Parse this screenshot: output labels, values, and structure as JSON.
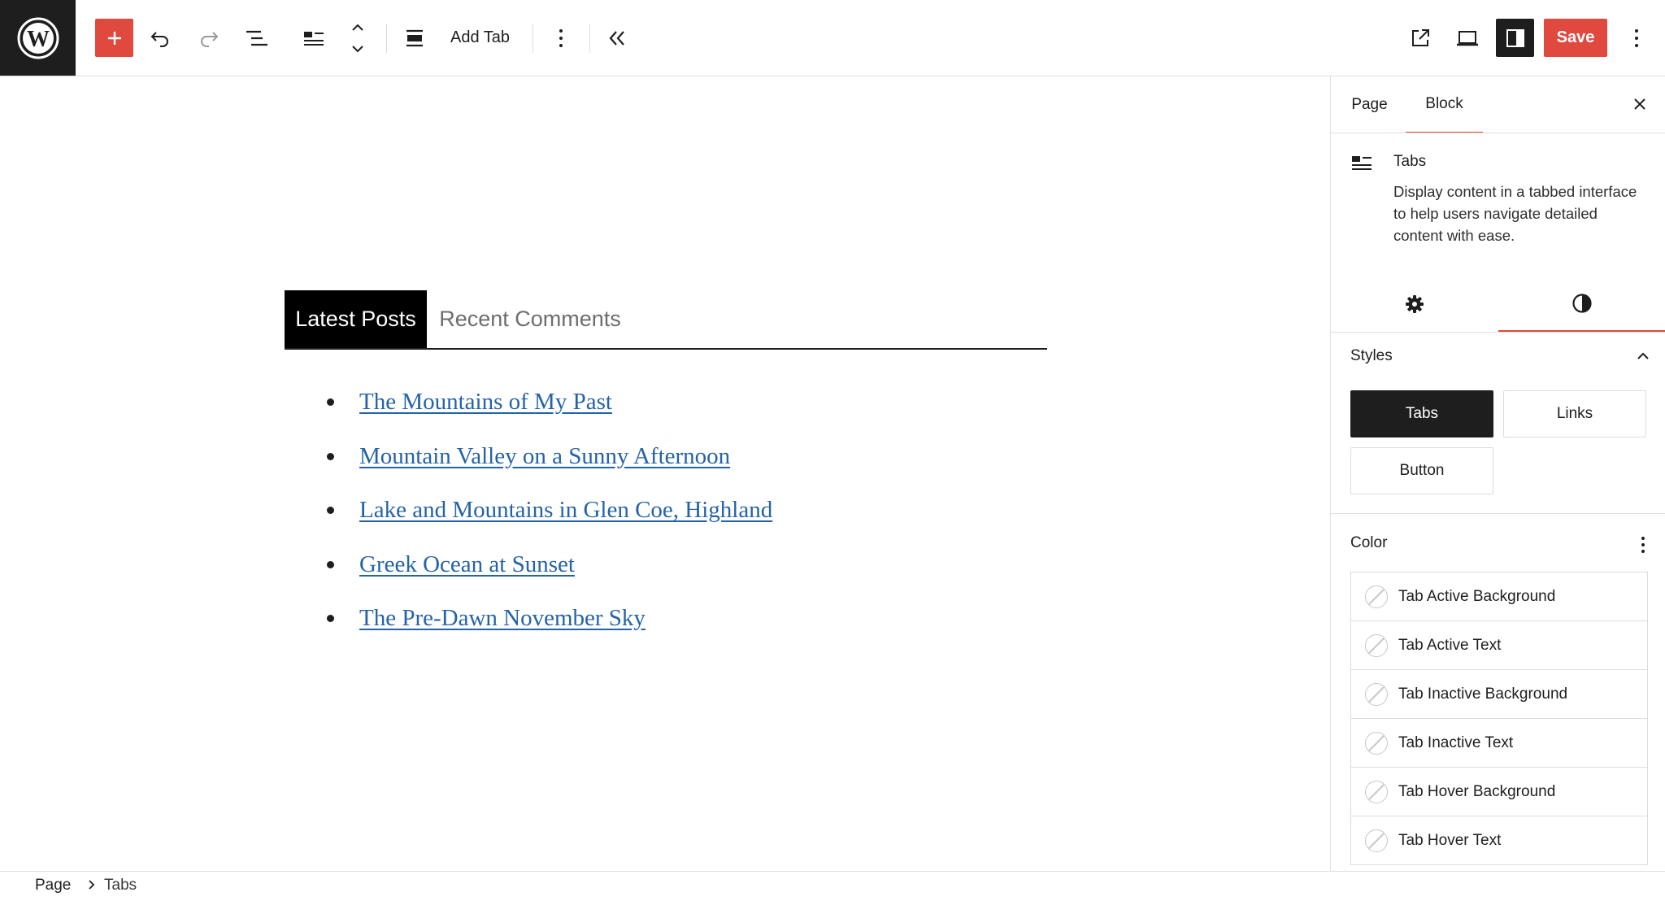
{
  "toolbar": {
    "add_tab_label": "Add Tab",
    "save_label": "Save",
    "accent_color": "#e0493d",
    "icons": [
      "wordpress-logo",
      "plus",
      "undo",
      "redo",
      "document-overview",
      "tabs-block",
      "move-up-down",
      "align",
      "more-vertical",
      "collapse",
      "external-preview",
      "device-preview",
      "sidebar-settings",
      "more-vertical"
    ]
  },
  "canvas": {
    "tabs": [
      {
        "label": "Latest Posts",
        "active": true
      },
      {
        "label": "Recent Comments",
        "active": false
      }
    ],
    "posts": [
      "The Mountains of My Past",
      "Mountain Valley on a Sunny Afternoon",
      "Lake and Mountains in Glen Coe, Highland",
      "Greek Ocean at Sunset",
      "The Pre-Dawn November Sky"
    ],
    "link_color": "#2563a8"
  },
  "sidebar": {
    "tabs": {
      "page": "Page",
      "block": "Block"
    },
    "block_card": {
      "title": "Tabs",
      "description": "Display content in a tabbed interface to help users navigate detailed content with ease."
    },
    "styles": {
      "title": "Styles",
      "options": [
        "Tabs",
        "Links",
        "Button"
      ],
      "selected": "Tabs"
    },
    "color": {
      "title": "Color",
      "items": [
        "Tab Active Background",
        "Tab Active Text",
        "Tab Inactive Background",
        "Tab Inactive Text",
        "Tab Hover Background",
        "Tab Hover Text"
      ]
    }
  },
  "breadcrumb": {
    "items": [
      "Page",
      "Tabs"
    ]
  }
}
